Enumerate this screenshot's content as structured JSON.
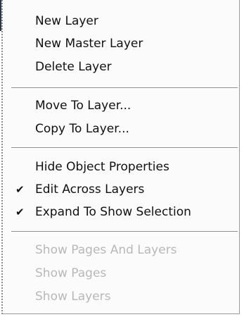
{
  "menu": {
    "groups": [
      {
        "items": [
          {
            "label": "New Layer",
            "enabled": true,
            "checked": false
          },
          {
            "label": "New Master Layer",
            "enabled": true,
            "checked": false
          },
          {
            "label": "Delete Layer",
            "enabled": true,
            "checked": false
          }
        ]
      },
      {
        "items": [
          {
            "label": "Move To Layer...",
            "enabled": true,
            "checked": false
          },
          {
            "label": "Copy To Layer...",
            "enabled": true,
            "checked": false
          }
        ]
      },
      {
        "items": [
          {
            "label": "Hide Object Properties",
            "enabled": true,
            "checked": false
          },
          {
            "label": "Edit Across Layers",
            "enabled": true,
            "checked": true
          },
          {
            "label": "Expand To Show Selection",
            "enabled": true,
            "checked": true
          }
        ]
      },
      {
        "items": [
          {
            "label": "Show Pages And Layers",
            "enabled": false,
            "checked": false
          },
          {
            "label": "Show Pages",
            "enabled": false,
            "checked": false
          },
          {
            "label": "Show Layers",
            "enabled": false,
            "checked": false
          }
        ]
      }
    ],
    "check_glyph": "✔",
    "colors": {
      "text": "#111111",
      "disabled_text": "#b8b8b8",
      "background": "#fbfbfb",
      "separator": "#8f8f8f"
    }
  }
}
